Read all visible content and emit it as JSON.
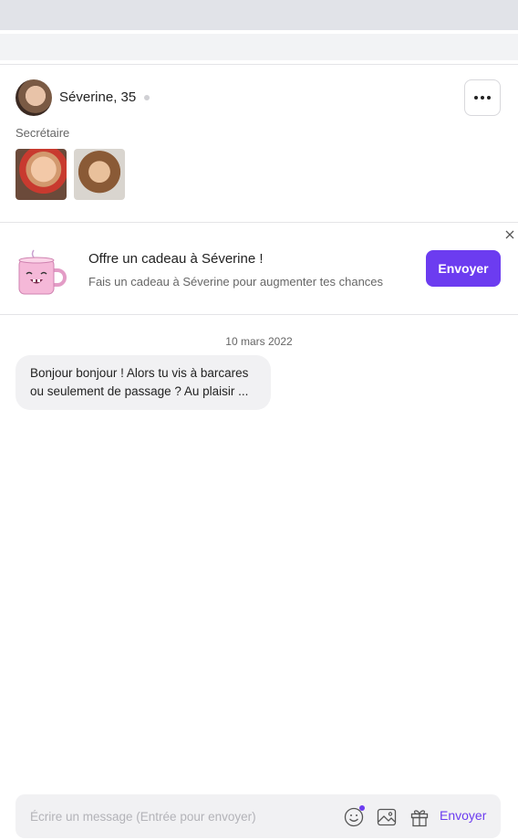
{
  "profile": {
    "name_age": "Séverine, 35",
    "job": "Secrétaire"
  },
  "gift_banner": {
    "title": "Offre un cadeau à Séverine !",
    "subtitle": "Fais un cadeau à Séverine pour augmenter tes chances",
    "send_label": "Envoyer"
  },
  "chat": {
    "date": "10 mars 2022",
    "messages": [
      {
        "text": "Bonjour bonjour ! Alors tu vis à barcares ou seulement de passage ? Au plaisir ..."
      }
    ]
  },
  "composer": {
    "placeholder": "Écrire un message (Entrée pour envoyer)",
    "send_label": "Envoyer"
  },
  "colors": {
    "accent": "#6c3cf0",
    "bubble": "#f1f1f3",
    "mug": "#f5b8d8"
  },
  "icons": [
    "more-icon",
    "close-icon",
    "mug-icon",
    "emoji-icon",
    "image-icon",
    "gift-icon"
  ]
}
